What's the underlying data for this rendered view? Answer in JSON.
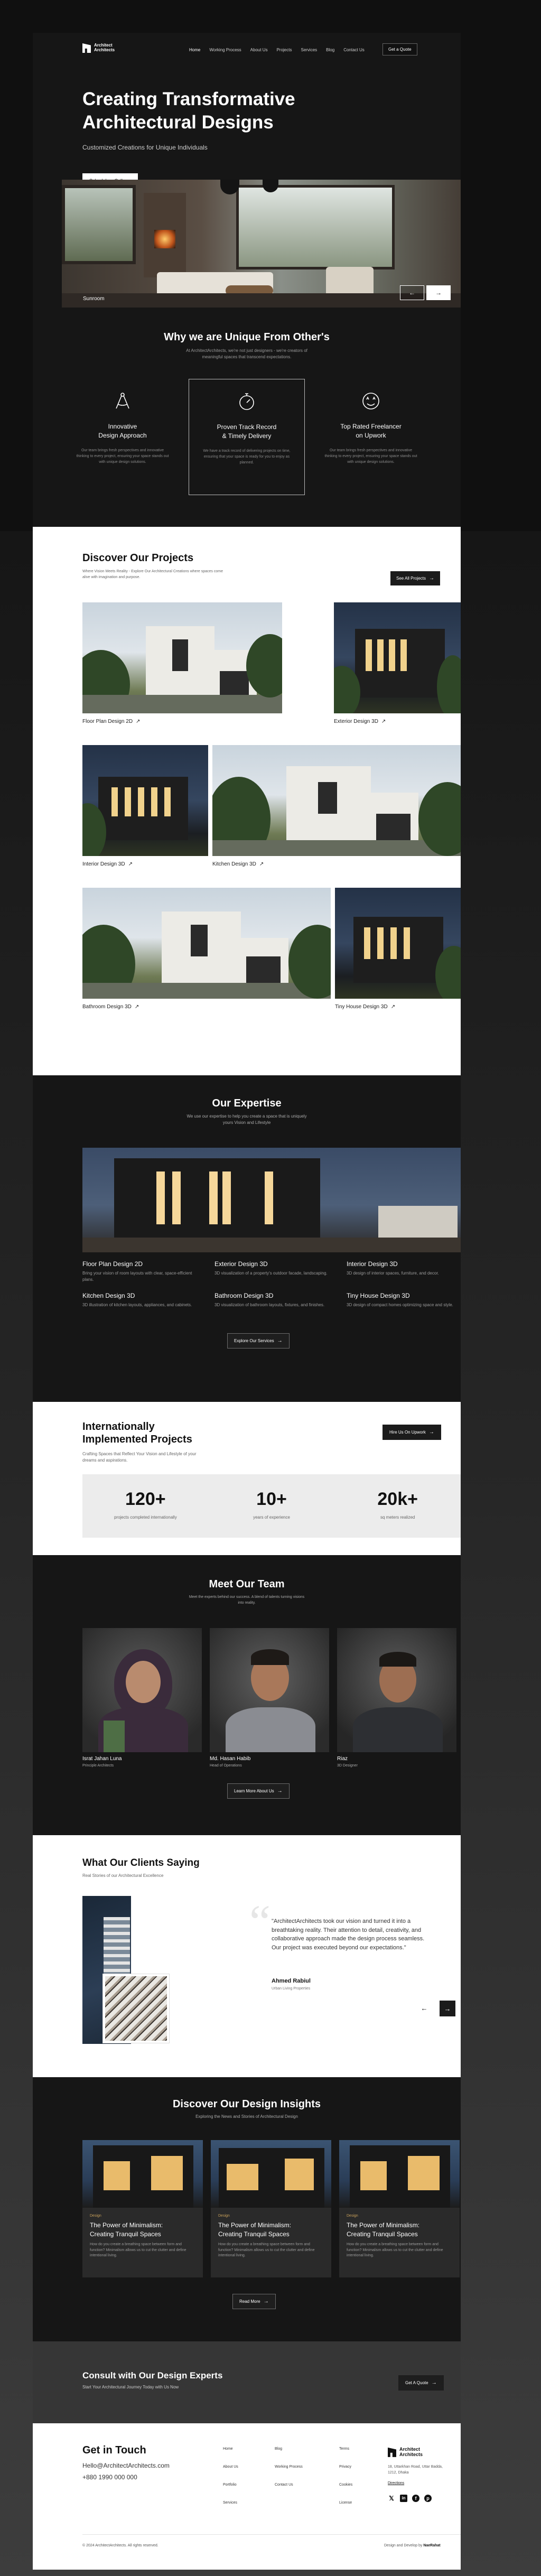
{
  "nav": {
    "logo": "Architect\nArchitects",
    "logo_line1": "Architect",
    "logo_line2": "Architects",
    "links": [
      "Home",
      "Working Process",
      "About Us",
      "Projects",
      "Services",
      "Blog",
      "Contact Us"
    ],
    "cta": "Get a Quote"
  },
  "hero": {
    "title_line1": "Creating Transformative",
    "title_line2": "Architectural Designs",
    "subtitle": "Customized Creations for Unique Individuals",
    "cta": "Schedule a Call",
    "image_label": "Sunroom",
    "prev": "←",
    "next": "→"
  },
  "unique": {
    "title": "Why we are Unique From Other's",
    "subtitle": "At ArchitectArchitects, we're not just designers - we're creators of meaningful spaces that transcend expectations.",
    "cards": [
      {
        "icon": "compass-icon",
        "title_line1": "Innovative",
        "title_line2": "Design Approach",
        "text": "Our team brings fresh perspectives and innovative thinking to every project, ensuring your space stands out with unique design solutions."
      },
      {
        "icon": "stopwatch-icon",
        "title_line1": "Proven Track Record",
        "title_line2": "& Timely Delivery",
        "text": "We have a track record of delivering projects on time, ensuring that your space is ready for you to enjoy as planned."
      },
      {
        "icon": "star-face-icon",
        "title_line1": "Top Rated Freelancer",
        "title_line2": "on Upwork",
        "text": "Our team brings fresh perspectives and innovative thinking to every project, ensuring your space stands out with unique design solutions."
      }
    ]
  },
  "projects": {
    "title": "Discover Our Projects",
    "subtitle": "Where Vision Meets Reality - Explore Our Architectural Creations where spaces come alive with imagination and purpose.",
    "cta": "See All Projects",
    "items": [
      "Floor Plan Design 2D",
      "Exterior Design 3D",
      "Interior Design 3D",
      "Kitchen Design 3D",
      "Bathroom Design 3D",
      "Tiny House Design 3D"
    ]
  },
  "expertise": {
    "title": "Our Expertise",
    "subtitle": "We use our expertise to help you create a space that is uniquely yours Vision and Lifestyle",
    "items": [
      {
        "title": "Floor Plan Design 2D",
        "text": "Bring your vision of room layouts with clear, space-efficient plans."
      },
      {
        "title": "Exterior Design 3D",
        "text": "3D visualization of a property's outdoor facade, landscaping."
      },
      {
        "title": "Interior Design 3D",
        "text": "3D design of interior spaces, furniture, and decor."
      },
      {
        "title": "Kitchen Design 3D",
        "text": "3D illustration of kitchen layouts, appliances, and cabinets."
      },
      {
        "title": "Bathroom Design 3D",
        "text": "3D visualization of bathroom layouts, fixtures, and finishes."
      },
      {
        "title": "Tiny House Design 3D",
        "text": "3D design of compact homes optimizing space and style."
      }
    ],
    "cta": "Explore Our Services"
  },
  "intl": {
    "title_line1": "Internationally",
    "title_line2": "Implemented Projects",
    "subtitle": "Crafting Spaces that Reflect Your Vision and Lifestyle of your dreams and aspirations.",
    "cta": "Hire Us On Upwork",
    "stats": [
      {
        "value": "120+",
        "label": "projects completed internationally"
      },
      {
        "value": "10+",
        "label": "years of experience"
      },
      {
        "value": "20k+",
        "label": "sq meters realized"
      }
    ]
  },
  "team": {
    "title": "Meet Our Team",
    "subtitle": "Meet the experts behind our success. A blend of talents turning visions into reality.",
    "members": [
      {
        "name": "Israt Jahan Luna",
        "role": "Principle Architects"
      },
      {
        "name": "Md. Hasan Habib",
        "role": "Head of Operations"
      },
      {
        "name": "Riaz",
        "role": "3D Designer"
      }
    ],
    "cta": "Learn More About Us"
  },
  "testimonials": {
    "title": "What Our Clients Saying",
    "subtitle": "Real Stories of our Architectural Excellence",
    "quote": "\"ArchitectArchitects took our vision and turned it into a breathtaking reality. Their attention to detail, creativity, and collaborative approach made the design process seamless. Our project was executed beyond our expectations.\"",
    "author": "Ahmed Rabiul",
    "author_role": "Urban Living Properties",
    "prev": "←",
    "next": "→"
  },
  "insights": {
    "title": "Discover Our Design Insights",
    "subtitle": "Exploring the News and Stories of Architectural Design",
    "posts": [
      {
        "tag": "Design",
        "title_line1": "The Power of Minimalism:",
        "title_line2": "Creating Tranquil Spaces",
        "text": "How do you create a breathing space between form and function? Minimalism allows us to cut the clutter and define intentional living."
      },
      {
        "tag": "Design",
        "title_line1": "The Power of Minimalism:",
        "title_line2": "Creating Tranquil Spaces",
        "text": "How do you create a breathing space between form and function? Minimalism allows us to cut the clutter and define intentional living."
      },
      {
        "tag": "Design",
        "title_line1": "The Power of Minimalism:",
        "title_line2": "Creating Tranquil Spaces",
        "text": "How do you create a breathing space between form and function? Minimalism allows us to cut the clutter and define intentional living."
      }
    ],
    "cta": "Read More"
  },
  "consult": {
    "title": "Consult with Our Design Experts",
    "subtitle": "Start Your Architectural Journey Today with Us Now",
    "cta": "Get A Quote"
  },
  "footer": {
    "title": "Get in Touch",
    "email": "Hello@ArchitectArchitects.com",
    "phone": "+880 1990 000 000",
    "col1": [
      "Home",
      "About Us",
      "Portfolio",
      "Services"
    ],
    "col2": [
      "Blog",
      "Working Process",
      "Contact Us"
    ],
    "col3": [
      "Terms",
      "Privacy",
      "Cookies",
      "License"
    ],
    "logo_line1": "Architect",
    "logo_line2": "Architects",
    "address": "18, Uttarkhan Road, Uttar Badda, 1212, Dhaka",
    "map_link": "Directions",
    "copyright": "© 2024 ArchitectArchitects. All rights reserved.",
    "credit_prefix": "Design and Develop by",
    "credit_name": "NaeRahat"
  },
  "colors": {
    "dark": "#161616",
    "light": "#ffffff",
    "accent_gold": "#c9a15a"
  }
}
